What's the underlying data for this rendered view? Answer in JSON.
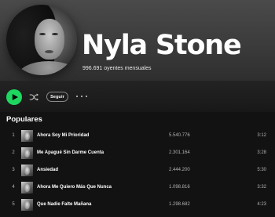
{
  "artist": {
    "name": "Nyla Stone",
    "monthly_listeners": "996.691 oyentes mensuales"
  },
  "actions": {
    "play_icon": "play-icon",
    "shuffle_icon": "shuffle-icon",
    "follow_label": "Seguir",
    "more_icon": "more-options-icon"
  },
  "popular": {
    "title": "Populares",
    "tracks": [
      {
        "num": "1",
        "title": "Ahora Soy Mi Prioridad",
        "plays": "5.540.776",
        "duration": "3:12"
      },
      {
        "num": "2",
        "title": "Me Apagué Sin Darme Cuenta",
        "plays": "2.301.164",
        "duration": "3:28"
      },
      {
        "num": "3",
        "title": "Ansiedad",
        "plays": "2.444.200",
        "duration": "5:30"
      },
      {
        "num": "4",
        "title": "Ahora Me Quiero Más Que Nunca",
        "plays": "1.098.816",
        "duration": "3:32"
      },
      {
        "num": "5",
        "title": "Que Nadie Falte Mañana",
        "plays": "1.298.682",
        "duration": "4:23"
      }
    ]
  },
  "colors": {
    "accent": "#1ed760",
    "background": "#121212"
  }
}
